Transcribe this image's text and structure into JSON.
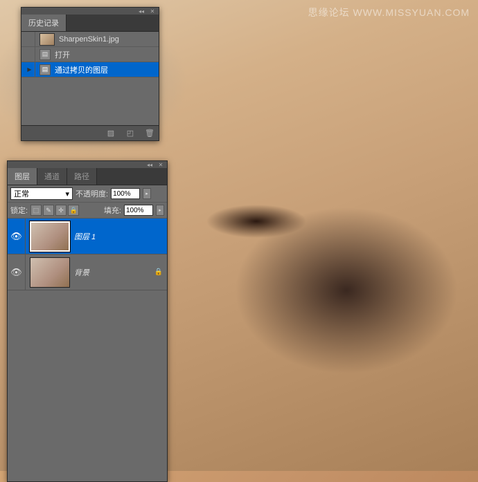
{
  "watermark": "思缘论坛  WWW.MISSYUAN.COM",
  "history": {
    "tab": "历史记录",
    "snapshot_name": "SharpenSkin1.jpg",
    "items": [
      {
        "label": "打开",
        "selected": false
      },
      {
        "label": "通过拷贝的图层",
        "selected": true
      }
    ]
  },
  "layers": {
    "tabs": [
      "图层",
      "通道",
      "路径"
    ],
    "active_tab": 0,
    "blend_mode": "正常",
    "opacity_label": "不透明度:",
    "opacity_value": "100%",
    "lock_label": "锁定:",
    "fill_label": "填充:",
    "fill_value": "100%",
    "items": [
      {
        "name": "图层 1",
        "visible": true,
        "selected": true,
        "locked": false
      },
      {
        "name": "背景",
        "visible": true,
        "selected": false,
        "locked": true
      }
    ]
  }
}
